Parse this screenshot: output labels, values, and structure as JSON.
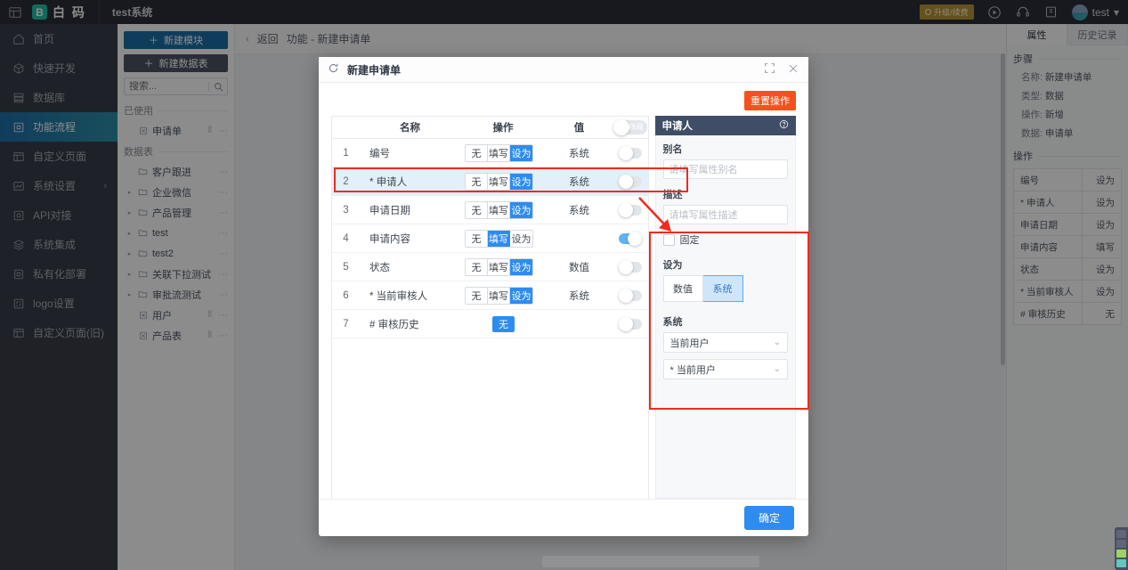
{
  "topbar": {
    "system_name": "test系统",
    "logo_text": "白 码",
    "logo_mark": "B",
    "upgrade_badge": "升级/续费",
    "username": "test",
    "icons": [
      "collapse-icon",
      "play-icon",
      "support-icon",
      "doc-icon"
    ]
  },
  "leftnav": {
    "items": [
      {
        "label": "首页",
        "icon": "home-icon",
        "active": false,
        "chevron": ""
      },
      {
        "label": "快速开发",
        "icon": "cube-icon",
        "active": false,
        "chevron": ""
      },
      {
        "label": "数据库",
        "icon": "database-icon",
        "active": false,
        "chevron": ""
      },
      {
        "label": "功能流程",
        "icon": "flow-icon",
        "active": true,
        "chevron": ""
      },
      {
        "label": "自定义页面",
        "icon": "page-icon",
        "active": false,
        "chevron": ""
      },
      {
        "label": "系统设置",
        "icon": "settings-icon",
        "active": false,
        "chevron": "›"
      },
      {
        "label": "API对接",
        "icon": "api-icon",
        "active": false,
        "chevron": ""
      },
      {
        "label": "系统集成",
        "icon": "integration-icon",
        "active": false,
        "chevron": ""
      },
      {
        "label": "私有化部署",
        "icon": "deploy-icon",
        "active": false,
        "chevron": ""
      },
      {
        "label": "logo设置",
        "icon": "logo-icon",
        "active": false,
        "chevron": ""
      },
      {
        "label": "自定义页面(旧)",
        "icon": "page-old-icon",
        "active": false,
        "chevron": ""
      }
    ]
  },
  "tree": {
    "new_module_btn": "新建模块",
    "new_table_btn": "新建数据表",
    "search_placeholder": "搜索...",
    "group_used": "已使用",
    "group_tables": "数据表",
    "used_items": [
      {
        "label": "申请单",
        "icon": "form-icon",
        "arrow": "",
        "has_slider": true
      }
    ],
    "table_items": [
      {
        "label": "客户跟进",
        "icon": "folder-icon",
        "arrow": "",
        "has_slider": false
      },
      {
        "label": "企业微信",
        "icon": "folder-icon",
        "arrow": "▸",
        "has_slider": false
      },
      {
        "label": "产品管理",
        "icon": "folder-icon",
        "arrow": "▸",
        "has_slider": false
      },
      {
        "label": "test",
        "icon": "folder-icon",
        "arrow": "▸",
        "has_slider": false
      },
      {
        "label": "test2",
        "icon": "folder-icon",
        "arrow": "▸",
        "has_slider": false
      },
      {
        "label": "关联下拉测试",
        "icon": "folder-icon",
        "arrow": "▸",
        "has_slider": false
      },
      {
        "label": "审批流测试",
        "icon": "folder-icon",
        "arrow": "▸",
        "has_slider": false
      },
      {
        "label": "用户",
        "icon": "table-icon",
        "arrow": "",
        "has_slider": true
      },
      {
        "label": "产品表",
        "icon": "table-icon",
        "arrow": "",
        "has_slider": true
      }
    ],
    "more_glyph": "···"
  },
  "breadcrumb": {
    "back": "返回",
    "path": "功能 - 新建申请单",
    "chevron": "‹"
  },
  "rightpanel": {
    "tabs": [
      {
        "label": "属性",
        "active": true
      },
      {
        "label": "历史记录",
        "active": false
      }
    ],
    "section_step": "步骤",
    "step_fields": [
      {
        "key": "名称:",
        "value": "新建申请单"
      },
      {
        "key": "类型:",
        "value": "数据"
      },
      {
        "key": "操作:",
        "value": "新增"
      },
      {
        "key": "数据:",
        "value": "申请单"
      }
    ],
    "section_op": "操作",
    "op_rows": [
      {
        "name": "编号",
        "value": "设为"
      },
      {
        "name": "* 申请人",
        "value": "设为"
      },
      {
        "name": "申请日期",
        "value": "设为"
      },
      {
        "name": "申请内容",
        "value": "填写"
      },
      {
        "name": "状态",
        "value": "设为"
      },
      {
        "name": "* 当前审核人",
        "value": "设为"
      },
      {
        "name": "# 审核历史",
        "value": "无"
      }
    ]
  },
  "modal": {
    "title": "新建申请单",
    "refresh_icon": "refresh-icon",
    "expand_icon": "fullscreen-icon",
    "close_icon": "close-icon",
    "reset_button": "重置操作",
    "confirm_button": "确定",
    "table": {
      "headers": [
        "",
        "名称",
        "操作",
        "值",
        ""
      ],
      "header_toggle": {
        "on": false,
        "label": "隐藏"
      },
      "rows": [
        {
          "idx": "1",
          "name": "编号",
          "ops": [
            "无",
            "填写",
            "设为"
          ],
          "selected": "设为",
          "value": "系统",
          "toggle": false
        },
        {
          "idx": "2",
          "name": "* 申请人",
          "ops": [
            "无",
            "填写",
            "设为"
          ],
          "selected": "设为",
          "value": "系统",
          "toggle": false,
          "row_selected": true
        },
        {
          "idx": "3",
          "name": "申请日期",
          "ops": [
            "无",
            "填写",
            "设为"
          ],
          "selected": "设为",
          "value": "系统",
          "toggle": false
        },
        {
          "idx": "4",
          "name": "申请内容",
          "ops": [
            "无",
            "填写",
            "设为"
          ],
          "selected": "填写",
          "value": "",
          "toggle": true
        },
        {
          "idx": "5",
          "name": "状态",
          "ops": [
            "无",
            "填写",
            "设为"
          ],
          "selected": "设为",
          "value": "数值",
          "toggle": false
        },
        {
          "idx": "6",
          "name": "* 当前审核人",
          "ops": [
            "无",
            "填写",
            "设为"
          ],
          "selected": "设为",
          "value": "系统",
          "toggle": false
        },
        {
          "idx": "7",
          "name": "# 审核历史",
          "ops": [
            "无"
          ],
          "selected": "无",
          "value": "",
          "toggle": false
        }
      ]
    },
    "pane": {
      "title": "申请人",
      "help_icon": "question-icon",
      "alias_label": "别名",
      "alias_placeholder": "请填写属性别名",
      "alias_value": "",
      "desc_label": "描述",
      "desc_placeholder": "请填写属性描述",
      "desc_value": "",
      "fixed_label": "固定",
      "fixed_checked": false,
      "setas_label": "设为",
      "setas_options": [
        {
          "label": "数值",
          "active": false
        },
        {
          "label": "系统",
          "active": true
        }
      ],
      "system_label": "系统",
      "system_select1": "当前用户",
      "system_select2": "* 当前用户",
      "chevron": "⌄"
    }
  },
  "annotations": {
    "row_highlight_color": "#ee2b1e",
    "pane_highlight_color": "#ee2b1e"
  },
  "colors": {
    "accent_blue": "#2d8cf0",
    "nav_active": "#1f6fa8",
    "reset_orange": "#f5511e",
    "pane_header": "#3f4e66"
  }
}
